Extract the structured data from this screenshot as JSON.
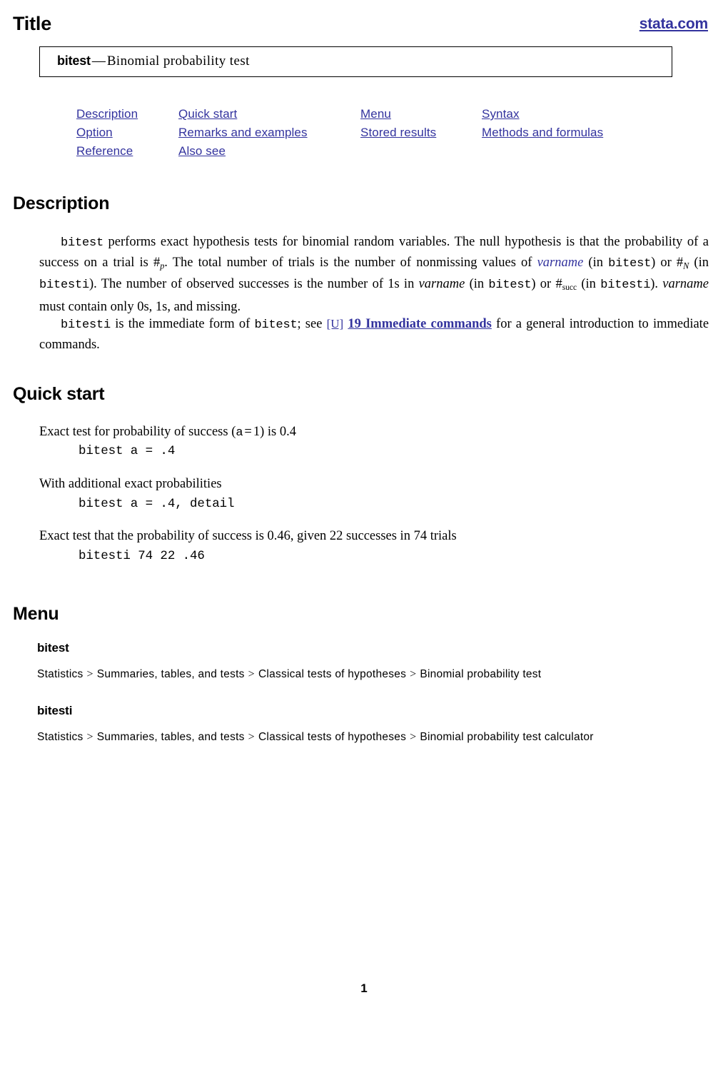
{
  "header": {
    "page_kind": "Title",
    "site_link": "stata.com"
  },
  "title_box": {
    "command": "bitest",
    "dash": "—",
    "description": "Binomial probability test"
  },
  "nav_links": [
    [
      "Description",
      "Quick start",
      "Menu",
      "Syntax"
    ],
    [
      "Option",
      "Remarks and examples",
      "Stored results",
      "Methods and formulas"
    ],
    [
      "Reference",
      "Also see",
      "",
      ""
    ]
  ],
  "sections": {
    "description": {
      "heading": "Description",
      "paragraph1": {
        "t1": "bitest",
        "t2": " performs exact hypothesis tests for binomial random variables. The null hypothesis is that the probability of a success on a trial is ",
        "hash1": "#",
        "sub1": "p",
        "t3": ". The total number of trials is the number of nonmissing values of ",
        "varname1": "varname",
        "t4": " (in ",
        "cmd1": "bitest",
        "t5": ") or ",
        "hash2": "#",
        "sub2": "N",
        "t6": " (in ",
        "cmd2": "bitesti",
        "t7": "). The number of observed successes is the number of 1s in ",
        "varname2": "varname",
        "t8": " (in ",
        "cmd3": "bitest",
        "t9": ") or ",
        "hash3": "#",
        "sub3": "succ",
        "t10": " (in ",
        "cmd4": "bitesti",
        "t11": "). ",
        "varname3": "varname",
        "t12": " must contain only 0s, 1s, and missing."
      },
      "paragraph2": {
        "cmd1": "bitesti",
        "t1": " is the immediate form of ",
        "cmd2": "bitest",
        "t2": "; see ",
        "link_u": "[U]",
        "link_title": "19 Immediate commands",
        "t3": " for a general introduction to immediate commands."
      }
    },
    "quick_start": {
      "heading": "Quick start",
      "items": [
        {
          "text_pre": "Exact test for probability of success (",
          "text_var": "a",
          "text_eq": "=",
          "text_val": "1",
          "text_post": ") is 0.4",
          "code": "bitest a = .4"
        },
        {
          "text_plain": "With additional exact probabilities",
          "code": "bitest a = .4, detail"
        },
        {
          "text_plain": "Exact test that the probability of success is 0.46, given 22 successes in 74 trials",
          "code": "bitesti 74 22 .46"
        }
      ]
    },
    "menu": {
      "heading": "Menu",
      "entries": [
        {
          "command": "bitest",
          "path": [
            "Statistics",
            "Summaries, tables, and tests",
            "Classical tests of hypotheses",
            "Binomial probability test"
          ]
        },
        {
          "command": "bitesti",
          "path": [
            "Statistics",
            "Summaries, tables, and tests",
            "Classical tests of hypotheses",
            "Binomial probability test calculator"
          ]
        }
      ],
      "separator": ">"
    }
  },
  "footer": {
    "page_number": "1"
  },
  "colors": {
    "link_blue": "#33339e",
    "text_black": "#000000",
    "background": "#ffffff"
  }
}
